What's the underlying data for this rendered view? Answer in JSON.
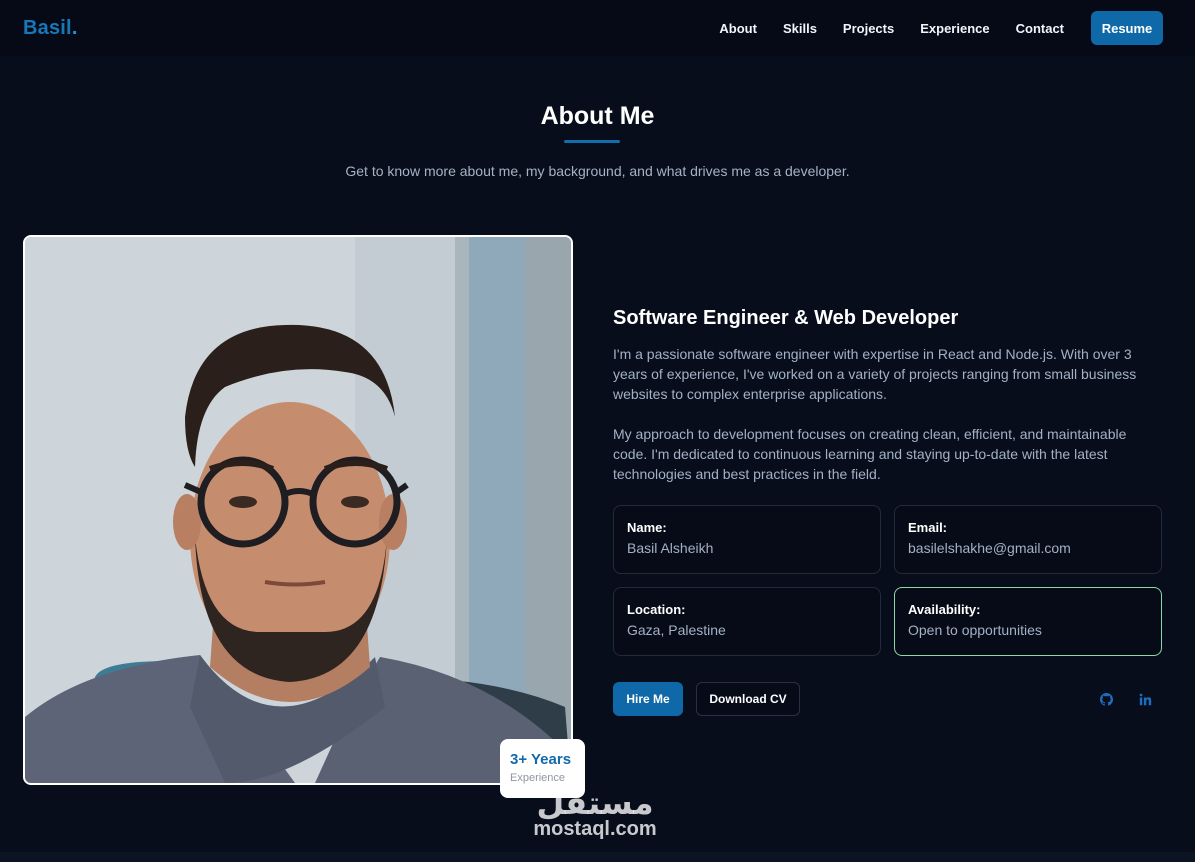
{
  "nav": {
    "logo": "Basil",
    "logo_dot": ".",
    "links": [
      "About",
      "Skills",
      "Projects",
      "Experience",
      "Contact"
    ],
    "resume_label": "Resume"
  },
  "section": {
    "title": "About Me",
    "subtitle": "Get to know more about me, my background, and what drives me as a developer."
  },
  "photo": {
    "badge_years": "3+ Years",
    "badge_label": "Experience"
  },
  "about": {
    "headline": "Software Engineer & Web Developer",
    "paragraph1": "I'm a passionate software engineer with expertise in React and Node.js. With over 3 years of experience, I've worked on a variety of projects ranging from small business websites to complex enterprise applications.",
    "paragraph2": "My approach to development focuses on creating clean, efficient, and maintainable code. I'm dedicated to continuous learning and staying up-to-date with the latest technologies and best practices in the field.",
    "info": {
      "name_label": "Name:",
      "name_value": "Basil Alsheikh",
      "email_label": "Email:",
      "email_value": "basilelshakhe@gmail.com",
      "location_label": "Location:",
      "location_value": "Gaza, Palestine",
      "availability_label": "Availability:",
      "availability_value": "Open to opportunities"
    },
    "hire_label": "Hire Me",
    "cv_label": "Download CV",
    "social_icons": [
      "github-icon",
      "linkedin-icon"
    ]
  },
  "watermark": {
    "arabic": "مستقل",
    "latin": "mostaql.com"
  },
  "colors": {
    "background": "#070d1b",
    "accent": "#0f69a8",
    "availability_border": "#8fd8a6"
  }
}
